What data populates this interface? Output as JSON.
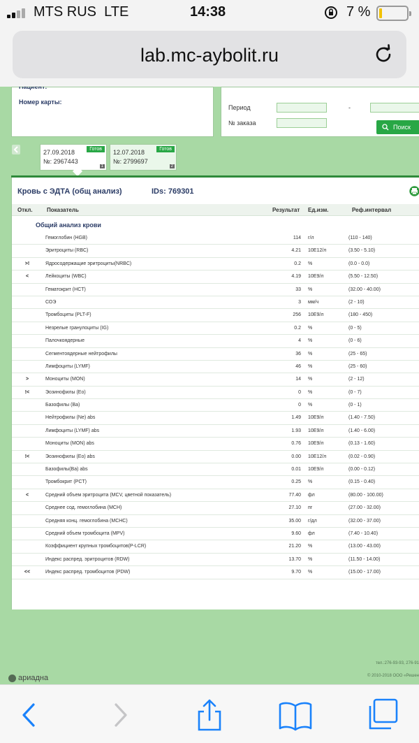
{
  "status_bar": {
    "carrier": "MTS RUS",
    "network": "LTE",
    "time": "14:38",
    "battery_text": "7 %",
    "battery_level": 0.07
  },
  "browser": {
    "url": "lab.mc-aybolit.ru"
  },
  "search_form": {
    "card_label": "Номер карты:",
    "period_label": "Период",
    "order_label": "№ заказа",
    "period_separator": "-",
    "search_button": "Поиск"
  },
  "orders": [
    {
      "date": "27.09.2018",
      "number": "№: 2967443",
      "status": "Готов",
      "index": "1"
    },
    {
      "date": "12.07.2018",
      "number": "№: 2799697",
      "status": "Готов",
      "index": "2"
    }
  ],
  "panel": {
    "title": "Кровь с ЭДТА (общ анализ)",
    "ids": "IDs: 769301",
    "columns": {
      "deviation": "Откл.",
      "parameter": "Показатель",
      "result": "Результат",
      "unit": "Ед.изм.",
      "reference": "Реф.интервал"
    },
    "group": "Общий анализ крови",
    "rows": [
      {
        "dev": "",
        "name": "Гемоглобин (HGB)",
        "result": "114",
        "unit": "г/л",
        "ref": "(110 - 140)"
      },
      {
        "dev": "",
        "name": "Эритроциты (RBC)",
        "result": "4.21",
        "unit": "10E12/л",
        "ref": "(3.50 - 5.10)"
      },
      {
        "dev": ">!",
        "name": "Ядросодержащие эритроциты(NRBC)",
        "result": "0.2",
        "unit": "%",
        "ref": "(0.0 - 0.0)"
      },
      {
        "dev": "<",
        "name": "Лейкоциты (WBC)",
        "result": "4.19",
        "unit": "10E9/л",
        "ref": "(5.50 - 12.50)"
      },
      {
        "dev": "",
        "name": "Гематокрит (HCT)",
        "result": "33",
        "unit": "%",
        "ref": "(32.00 - 40.00)"
      },
      {
        "dev": "",
        "name": "СОЭ",
        "result": "3",
        "unit": "мм/ч",
        "ref": "(2 - 10)"
      },
      {
        "dev": "",
        "name": "Тромбоциты (PLT-F)",
        "result": "256",
        "unit": "10E9/л",
        "ref": "(180 - 450)"
      },
      {
        "dev": "",
        "name": "Незрелые гранулоциты (IG)",
        "result": "0.2",
        "unit": "%",
        "ref": "(0 - 5)"
      },
      {
        "dev": "",
        "name": "Палочкоядерные",
        "result": "4",
        "unit": "%",
        "ref": "(0 - 6)"
      },
      {
        "dev": "",
        "name": "Сегментоядерные нейтрофилы",
        "result": "36",
        "unit": "%",
        "ref": "(25 - 65)"
      },
      {
        "dev": "",
        "name": "Лимфоциты (LYMF)",
        "result": "46",
        "unit": "%",
        "ref": "(25 - 60)"
      },
      {
        "dev": ">",
        "name": "Моноциты (MON)",
        "result": "14",
        "unit": "%",
        "ref": "(2 - 12)"
      },
      {
        "dev": "!<",
        "name": "Эозинофилы (Eo)",
        "result": "0",
        "unit": "%",
        "ref": "(0 - 7)"
      },
      {
        "dev": "",
        "name": "Базофилы (Ba)",
        "result": "0",
        "unit": "%",
        "ref": "(0 - 1)"
      },
      {
        "dev": "",
        "name": "Нейтрофилы (Ne) abs",
        "result": "1.49",
        "unit": "10E9/л",
        "ref": "(1.40 - 7.50)"
      },
      {
        "dev": "",
        "name": "Лимфоциты (LYMF) abs",
        "result": "1.93",
        "unit": "10E9/л",
        "ref": "(1.40 - 6.00)"
      },
      {
        "dev": "",
        "name": "Моноциты (MON) abs",
        "result": "0.76",
        "unit": "10E9/л",
        "ref": "(0.13 - 1.60)"
      },
      {
        "dev": "!<",
        "name": "Эозинофилы (Eo) abs",
        "result": "0.00",
        "unit": "10E12/л",
        "ref": "(0.02 - 0.90)"
      },
      {
        "dev": "",
        "name": "Базофилы(Ba) abs",
        "result": "0.01",
        "unit": "10E9/л",
        "ref": "(0.00 - 0.12)"
      },
      {
        "dev": "",
        "name": "Тромбокрит (PCT)",
        "result": "0.25",
        "unit": "%",
        "ref": "(0.15 - 0.40)"
      },
      {
        "dev": "<",
        "name": "Средний объем эритроцита (MCV, цветной показатель)",
        "result": "77.40",
        "unit": "фл",
        "ref": "(80.00 - 100.00)"
      },
      {
        "dev": "",
        "name": "Среднее сод. гемоглобина (MCH)",
        "result": "27.10",
        "unit": "пг",
        "ref": "(27.00 - 32.00)"
      },
      {
        "dev": "",
        "name": "Средняя конц. гемоглобина (MCHC)",
        "result": "35.00",
        "unit": "г/дл",
        "ref": "(32.00 - 37.00)"
      },
      {
        "dev": "",
        "name": "Средний объем тромбоцита (MPV)",
        "result": "9.60",
        "unit": "фл",
        "ref": "(7.40 - 10.40)"
      },
      {
        "dev": "",
        "name": "Коэффициент крупных тромбоцитов(P-LCR)",
        "result": "21.20",
        "unit": "%",
        "ref": "(13.00 - 43.00)"
      },
      {
        "dev": "",
        "name": "Индекс распред. эритроцитов (RDW)",
        "result": "13.70",
        "unit": "%",
        "ref": "(11.50 - 14.00)"
      },
      {
        "dev": "<<",
        "name": "Индекс распред. тромбоцитов (PDW)",
        "result": "9.70",
        "unit": "%",
        "ref": "(15.00 - 17.00)"
      }
    ]
  },
  "footer": {
    "phone": "тел.:276-93-93, 276-91",
    "logo": "ариадна",
    "copyright": "© 2010-2018  ООО «Решен"
  },
  "colors": {
    "page_bg": "#a8d9a4",
    "accent_green": "#28a745",
    "title_navy": "#2b3c66",
    "ios_blue": "#1a82fb"
  }
}
